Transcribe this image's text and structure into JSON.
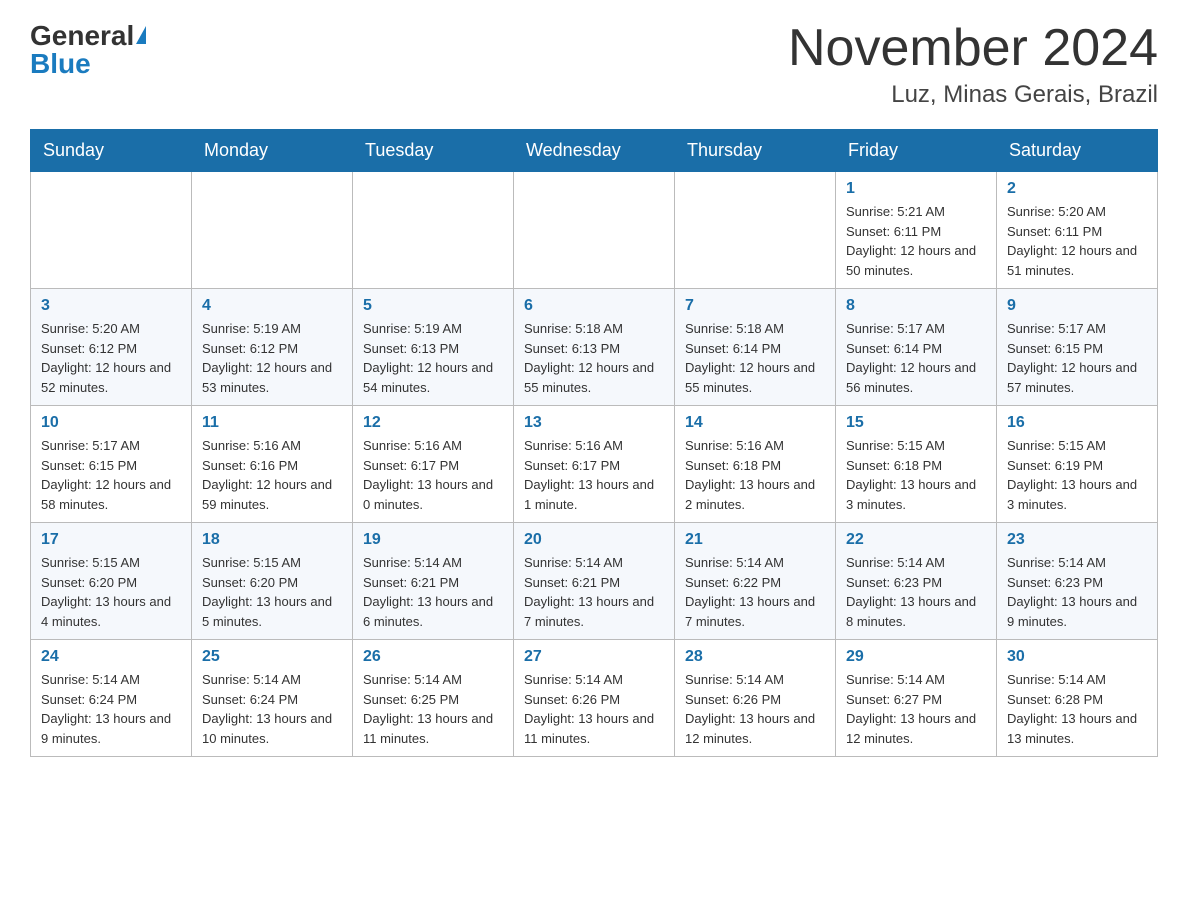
{
  "header": {
    "logo_general": "General",
    "logo_blue": "Blue",
    "month_title": "November 2024",
    "location": "Luz, Minas Gerais, Brazil"
  },
  "days_of_week": [
    "Sunday",
    "Monday",
    "Tuesday",
    "Wednesday",
    "Thursday",
    "Friday",
    "Saturday"
  ],
  "weeks": [
    [
      {
        "day": "",
        "sunrise": "",
        "sunset": "",
        "daylight": ""
      },
      {
        "day": "",
        "sunrise": "",
        "sunset": "",
        "daylight": ""
      },
      {
        "day": "",
        "sunrise": "",
        "sunset": "",
        "daylight": ""
      },
      {
        "day": "",
        "sunrise": "",
        "sunset": "",
        "daylight": ""
      },
      {
        "day": "",
        "sunrise": "",
        "sunset": "",
        "daylight": ""
      },
      {
        "day": "1",
        "sunrise": "Sunrise: 5:21 AM",
        "sunset": "Sunset: 6:11 PM",
        "daylight": "Daylight: 12 hours and 50 minutes."
      },
      {
        "day": "2",
        "sunrise": "Sunrise: 5:20 AM",
        "sunset": "Sunset: 6:11 PM",
        "daylight": "Daylight: 12 hours and 51 minutes."
      }
    ],
    [
      {
        "day": "3",
        "sunrise": "Sunrise: 5:20 AM",
        "sunset": "Sunset: 6:12 PM",
        "daylight": "Daylight: 12 hours and 52 minutes."
      },
      {
        "day": "4",
        "sunrise": "Sunrise: 5:19 AM",
        "sunset": "Sunset: 6:12 PM",
        "daylight": "Daylight: 12 hours and 53 minutes."
      },
      {
        "day": "5",
        "sunrise": "Sunrise: 5:19 AM",
        "sunset": "Sunset: 6:13 PM",
        "daylight": "Daylight: 12 hours and 54 minutes."
      },
      {
        "day": "6",
        "sunrise": "Sunrise: 5:18 AM",
        "sunset": "Sunset: 6:13 PM",
        "daylight": "Daylight: 12 hours and 55 minutes."
      },
      {
        "day": "7",
        "sunrise": "Sunrise: 5:18 AM",
        "sunset": "Sunset: 6:14 PM",
        "daylight": "Daylight: 12 hours and 55 minutes."
      },
      {
        "day": "8",
        "sunrise": "Sunrise: 5:17 AM",
        "sunset": "Sunset: 6:14 PM",
        "daylight": "Daylight: 12 hours and 56 minutes."
      },
      {
        "day": "9",
        "sunrise": "Sunrise: 5:17 AM",
        "sunset": "Sunset: 6:15 PM",
        "daylight": "Daylight: 12 hours and 57 minutes."
      }
    ],
    [
      {
        "day": "10",
        "sunrise": "Sunrise: 5:17 AM",
        "sunset": "Sunset: 6:15 PM",
        "daylight": "Daylight: 12 hours and 58 minutes."
      },
      {
        "day": "11",
        "sunrise": "Sunrise: 5:16 AM",
        "sunset": "Sunset: 6:16 PM",
        "daylight": "Daylight: 12 hours and 59 minutes."
      },
      {
        "day": "12",
        "sunrise": "Sunrise: 5:16 AM",
        "sunset": "Sunset: 6:17 PM",
        "daylight": "Daylight: 13 hours and 0 minutes."
      },
      {
        "day": "13",
        "sunrise": "Sunrise: 5:16 AM",
        "sunset": "Sunset: 6:17 PM",
        "daylight": "Daylight: 13 hours and 1 minute."
      },
      {
        "day": "14",
        "sunrise": "Sunrise: 5:16 AM",
        "sunset": "Sunset: 6:18 PM",
        "daylight": "Daylight: 13 hours and 2 minutes."
      },
      {
        "day": "15",
        "sunrise": "Sunrise: 5:15 AM",
        "sunset": "Sunset: 6:18 PM",
        "daylight": "Daylight: 13 hours and 3 minutes."
      },
      {
        "day": "16",
        "sunrise": "Sunrise: 5:15 AM",
        "sunset": "Sunset: 6:19 PM",
        "daylight": "Daylight: 13 hours and 3 minutes."
      }
    ],
    [
      {
        "day": "17",
        "sunrise": "Sunrise: 5:15 AM",
        "sunset": "Sunset: 6:20 PM",
        "daylight": "Daylight: 13 hours and 4 minutes."
      },
      {
        "day": "18",
        "sunrise": "Sunrise: 5:15 AM",
        "sunset": "Sunset: 6:20 PM",
        "daylight": "Daylight: 13 hours and 5 minutes."
      },
      {
        "day": "19",
        "sunrise": "Sunrise: 5:14 AM",
        "sunset": "Sunset: 6:21 PM",
        "daylight": "Daylight: 13 hours and 6 minutes."
      },
      {
        "day": "20",
        "sunrise": "Sunrise: 5:14 AM",
        "sunset": "Sunset: 6:21 PM",
        "daylight": "Daylight: 13 hours and 7 minutes."
      },
      {
        "day": "21",
        "sunrise": "Sunrise: 5:14 AM",
        "sunset": "Sunset: 6:22 PM",
        "daylight": "Daylight: 13 hours and 7 minutes."
      },
      {
        "day": "22",
        "sunrise": "Sunrise: 5:14 AM",
        "sunset": "Sunset: 6:23 PM",
        "daylight": "Daylight: 13 hours and 8 minutes."
      },
      {
        "day": "23",
        "sunrise": "Sunrise: 5:14 AM",
        "sunset": "Sunset: 6:23 PM",
        "daylight": "Daylight: 13 hours and 9 minutes."
      }
    ],
    [
      {
        "day": "24",
        "sunrise": "Sunrise: 5:14 AM",
        "sunset": "Sunset: 6:24 PM",
        "daylight": "Daylight: 13 hours and 9 minutes."
      },
      {
        "day": "25",
        "sunrise": "Sunrise: 5:14 AM",
        "sunset": "Sunset: 6:24 PM",
        "daylight": "Daylight: 13 hours and 10 minutes."
      },
      {
        "day": "26",
        "sunrise": "Sunrise: 5:14 AM",
        "sunset": "Sunset: 6:25 PM",
        "daylight": "Daylight: 13 hours and 11 minutes."
      },
      {
        "day": "27",
        "sunrise": "Sunrise: 5:14 AM",
        "sunset": "Sunset: 6:26 PM",
        "daylight": "Daylight: 13 hours and 11 minutes."
      },
      {
        "day": "28",
        "sunrise": "Sunrise: 5:14 AM",
        "sunset": "Sunset: 6:26 PM",
        "daylight": "Daylight: 13 hours and 12 minutes."
      },
      {
        "day": "29",
        "sunrise": "Sunrise: 5:14 AM",
        "sunset": "Sunset: 6:27 PM",
        "daylight": "Daylight: 13 hours and 12 minutes."
      },
      {
        "day": "30",
        "sunrise": "Sunrise: 5:14 AM",
        "sunset": "Sunset: 6:28 PM",
        "daylight": "Daylight: 13 hours and 13 minutes."
      }
    ]
  ]
}
